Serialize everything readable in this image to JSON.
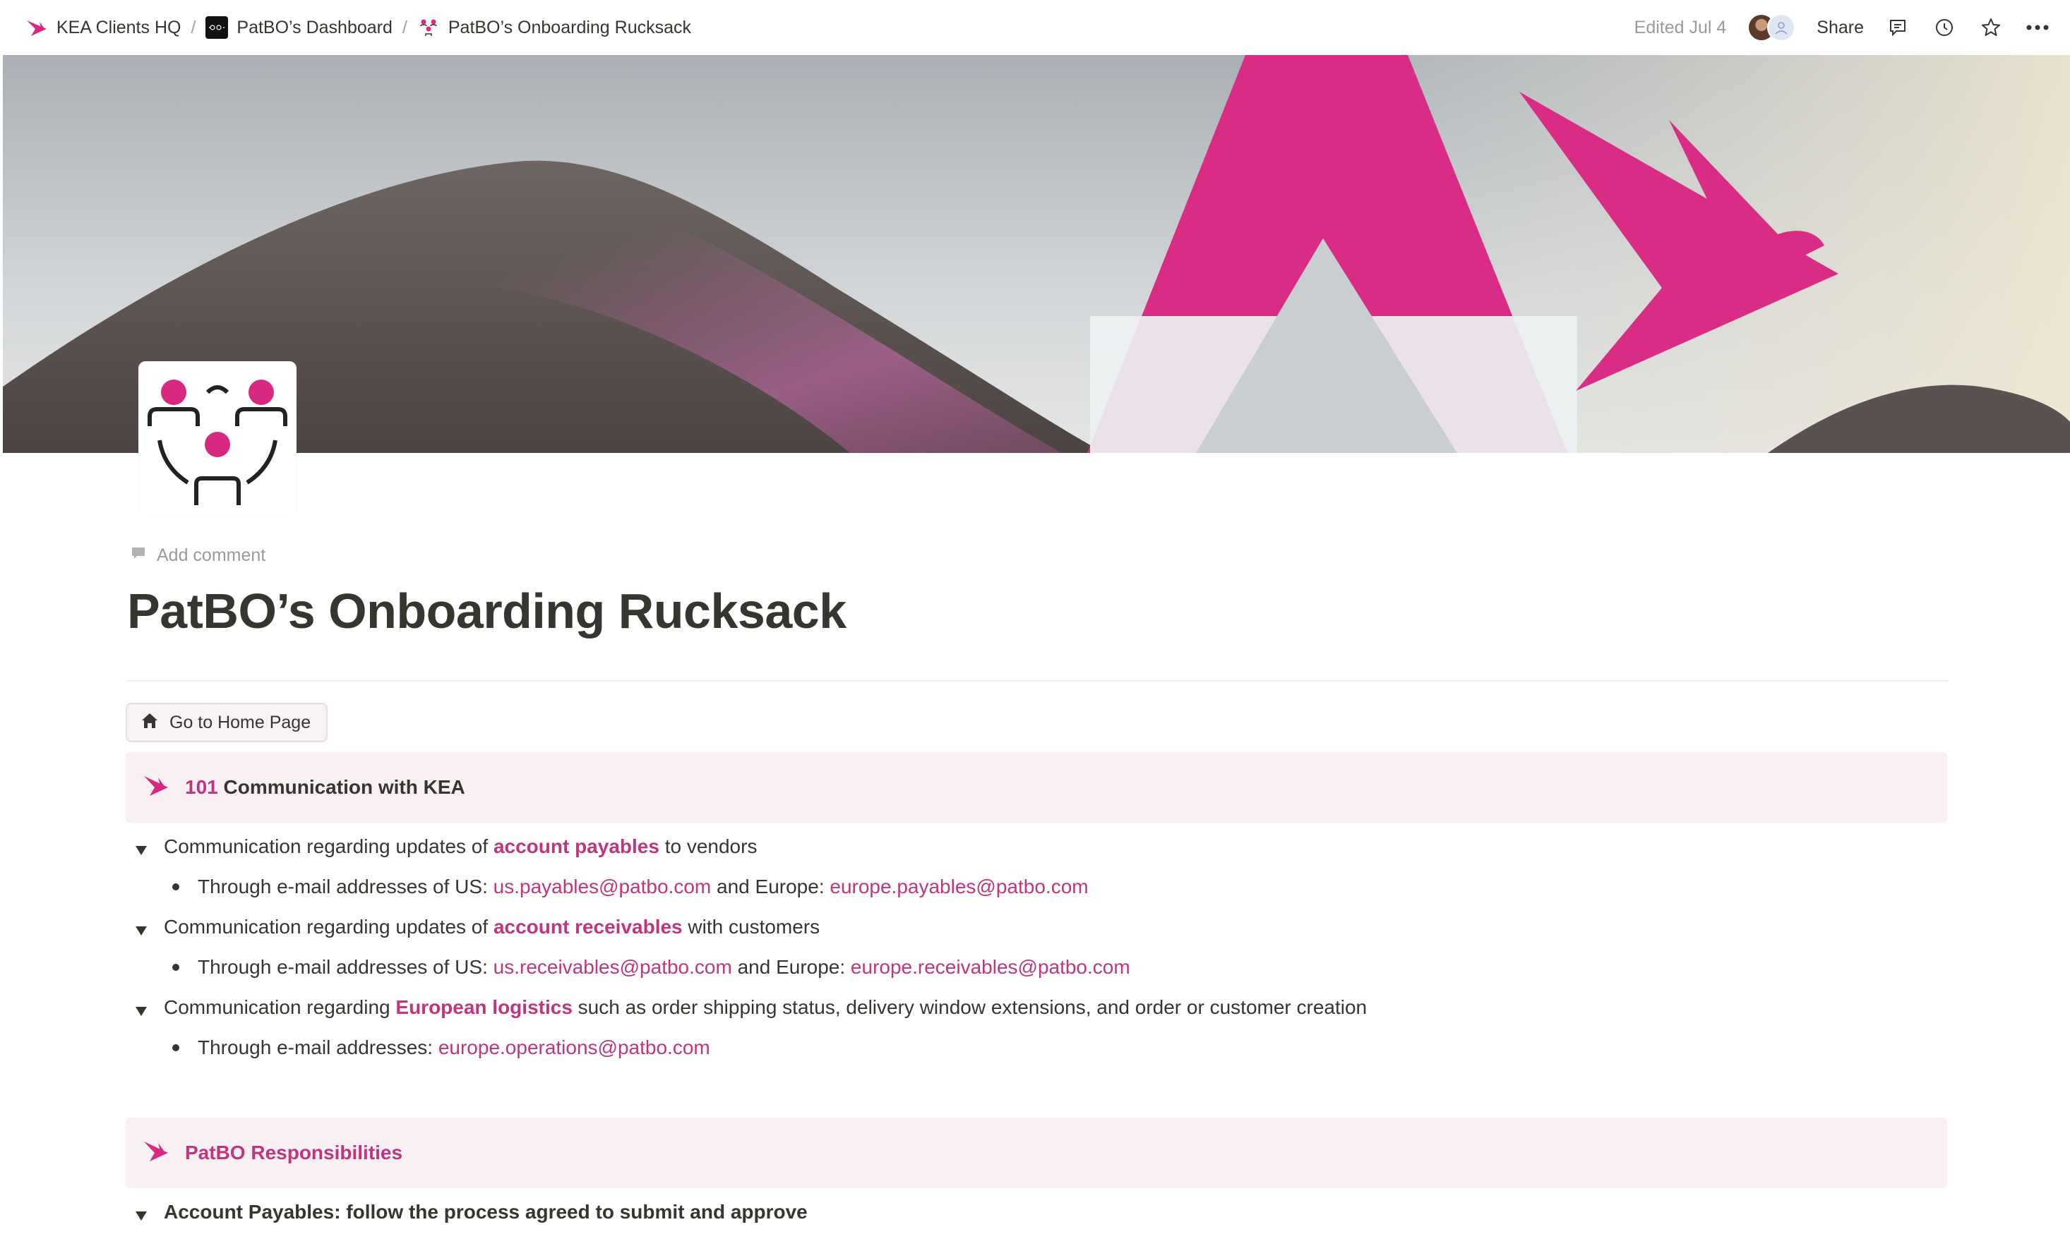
{
  "breadcrumb": {
    "items": [
      {
        "label": "KEA Clients HQ",
        "icon": "kea-bird-icon"
      },
      {
        "label": "PatBO’s Dashboard",
        "icon": "patbo-logo-icon"
      },
      {
        "label": "PatBO’s Onboarding Rucksack",
        "icon": "people-network-icon"
      }
    ],
    "separator": "/"
  },
  "topbar": {
    "edited": "Edited Jul 4",
    "share": "Share"
  },
  "page": {
    "add_comment": "Add comment",
    "title": "PatBO’s Onboarding Rucksack",
    "home_button": "Go to Home Page"
  },
  "section1": {
    "num": "101",
    "heading": "Communication with KEA",
    "items": [
      {
        "pre": "Communication regarding updates of ",
        "highlight": "account payables",
        "post": " to vendors",
        "sub_pre": "Through e-mail addresses of US: ",
        "link1": "us.payables@patbo.com",
        "sub_mid": " and Europe: ",
        "link2": "europe.payables@patbo.com"
      },
      {
        "pre": "Communication regarding updates of ",
        "highlight": "account receivables",
        "post": " with customers",
        "sub_pre": "Through e-mail addresses of US: ",
        "link1": "us.receivables@patbo.com",
        "sub_mid": " and Europe: ",
        "link2": "europe.receivables@patbo.com"
      },
      {
        "pre": "Communication regarding ",
        "highlight": "European logistics",
        "post": " such as order shipping status, delivery window extensions, and order or customer creation",
        "sub_pre": "Through e-mail addresses: ",
        "link1": "europe.operations@patbo.com"
      }
    ]
  },
  "section2": {
    "heading": "PatBO Responsibilities",
    "items": [
      {
        "label": "Account Payables: follow the process agreed to submit and approve"
      }
    ]
  },
  "colors": {
    "brand_pink": "#c0357d",
    "callout_bg": "#f8f0f2",
    "text": "#37352f"
  }
}
